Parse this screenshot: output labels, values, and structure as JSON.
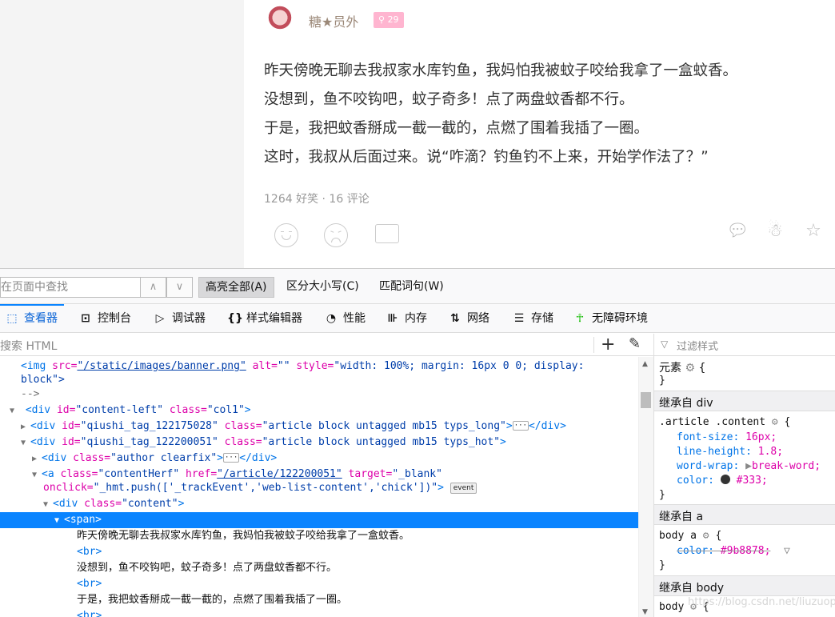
{
  "post": {
    "author": "糖★员外",
    "level": "29",
    "lines": [
      "昨天傍晚无聊去我叔家水库钓鱼，我妈怕我被蚊子咬给我拿了一盒蚊香。",
      "没想到，鱼不咬钩吧，蚊子奇多！点了两盘蚊香都不行。",
      "于是，我把蚊香掰成一截一截的，点燃了围着我插了一圈。",
      "这时，我叔从后面过来。说“咋滴？钓鱼钓不上来，开始学作法了？”"
    ],
    "stats": "1264 好笑 · 16 评论"
  },
  "findbar": {
    "placeholder": "在页面中查找",
    "prev": "∧",
    "next": "∨",
    "highlight_all": "高亮全部(A)",
    "match_case": "区分大小写(C)",
    "whole_words": "匹配词句(W)"
  },
  "devtools": {
    "tabs": [
      "查看器",
      "控制台",
      "调试器",
      "样式编辑器",
      "性能",
      "内存",
      "网络",
      "存储",
      "无障碍环境"
    ],
    "markup_search_placeholder": "搜索 HTML",
    "rules_filter_placeholder": "过滤样式"
  },
  "markup": {
    "l1a": "<img",
    "l1b": "src=",
    "l1c": "\"/static/images/banner.png\"",
    "l1d": "alt=",
    "l1e": "\"\"",
    "l1f": "style=",
    "l1g": "\"width: 100%; margin: 16px 0 0; display:",
    "l2": "block\">",
    "l3": "-->",
    "l4_tag": "<div",
    "l4_a1": "id=",
    "l4_v1": "\"content-left\"",
    "l4_a2": "class=",
    "l4_v2": "\"col1\"",
    "l4_end": ">",
    "l5_tag": "<div",
    "l5_a1": "id=",
    "l5_v1": "\"qiushi_tag_122175028\"",
    "l5_a2": "class=",
    "l5_v2": "\"article block untagged mb15 typs_long\"",
    "l5_end": ">",
    "l5_ell": "···",
    "l5_close": "</div>",
    "l6_tag": "<div",
    "l6_a1": "id=",
    "l6_v1": "\"qiushi_tag_122200051\"",
    "l6_a2": "class=",
    "l6_v2": "\"article block untagged mb15 typs_hot\"",
    "l6_end": ">",
    "l7_tag": "<div",
    "l7_a1": "class=",
    "l7_v1": "\"author clearfix\"",
    "l7_end": ">",
    "l7_ell": "···",
    "l7_close": "</div>",
    "l8_tag": "<a",
    "l8_a1": "class=",
    "l8_v1": "\"contentHerf\"",
    "l8_a2": "href=",
    "l8_v2": "\"/article/122200051\"",
    "l8_a3": "target=",
    "l8_v3": "\"_blank\"",
    "l9_a": "onclick=",
    "l9_v": "\"_hmt.push(['_trackEvent','web-list-content','chick'])\"",
    "l9_end": ">",
    "l9_event": "event",
    "l10_tag": "<div",
    "l10_a": "class=",
    "l10_v": "\"content\"",
    "l10_end": ">",
    "l11": "<span>",
    "l12": "昨天傍晚无聊去我叔家水库钓鱼，我妈怕我被蚊子咬给我拿了一盒蚊香。",
    "l13": "<br>",
    "l14": "没想到，鱼不咬钩吧，蚊子奇多！点了两盘蚊香都不行。",
    "l15": "<br>",
    "l16": "于是，我把蚊香掰成一截一截的，点燃了围着我插了一圈。",
    "l17": "<br>"
  },
  "rules": {
    "element_selector": "元素",
    "brace_open": "{",
    "brace_close": "}",
    "inherit_div": "继承自 div",
    "article_selector": ".article .content",
    "p1": "font-size:",
    "v1": "16px;",
    "p2": "line-height:",
    "v2": "1.8;",
    "p3": "word-wrap:",
    "v3": "break-word;",
    "p4": "color:",
    "v4": "#333;",
    "inherit_a": "继承自 a",
    "body_a_selector": "body a",
    "p5": "color:",
    "v5": "#9b8878;",
    "inherit_body": "继承自 body",
    "body_selector": "body"
  },
  "watermark": "https://blog.csdn.net/liuzuoping"
}
